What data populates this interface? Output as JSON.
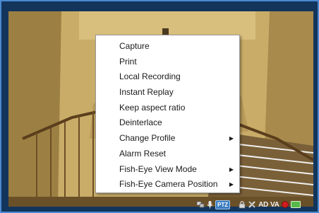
{
  "context_menu": {
    "items": [
      {
        "label": "Capture",
        "has_submenu": false
      },
      {
        "label": "Print",
        "has_submenu": false
      },
      {
        "label": "Local Recording",
        "has_submenu": false
      },
      {
        "label": "Instant Replay",
        "has_submenu": false
      },
      {
        "label": "Keep aspect ratio",
        "has_submenu": false
      },
      {
        "label": "Deinterlace",
        "has_submenu": false
      },
      {
        "label": "Change Profile",
        "has_submenu": true
      },
      {
        "label": "Alarm Reset",
        "has_submenu": false
      },
      {
        "label": "Fish-Eye View Mode",
        "has_submenu": true
      },
      {
        "label": "Fish-Eye Camera Position",
        "has_submenu": true
      }
    ],
    "submenu_arrow": "▶"
  },
  "status_bar": {
    "ptz_badge": "PTZ",
    "ad_label": "AD",
    "va_label": "VA",
    "icons": [
      "network-icon",
      "microphone-icon",
      "ptz-icon",
      "lock-icon",
      "tool-icon",
      "ad-indicator",
      "va-indicator",
      "record-icon",
      "camera-icon"
    ]
  },
  "colors": {
    "frame_border": "#4a8ad0",
    "frame_background": "#13355c",
    "menu_background": "#ffffff",
    "record_indicator": "#d21e1e"
  }
}
